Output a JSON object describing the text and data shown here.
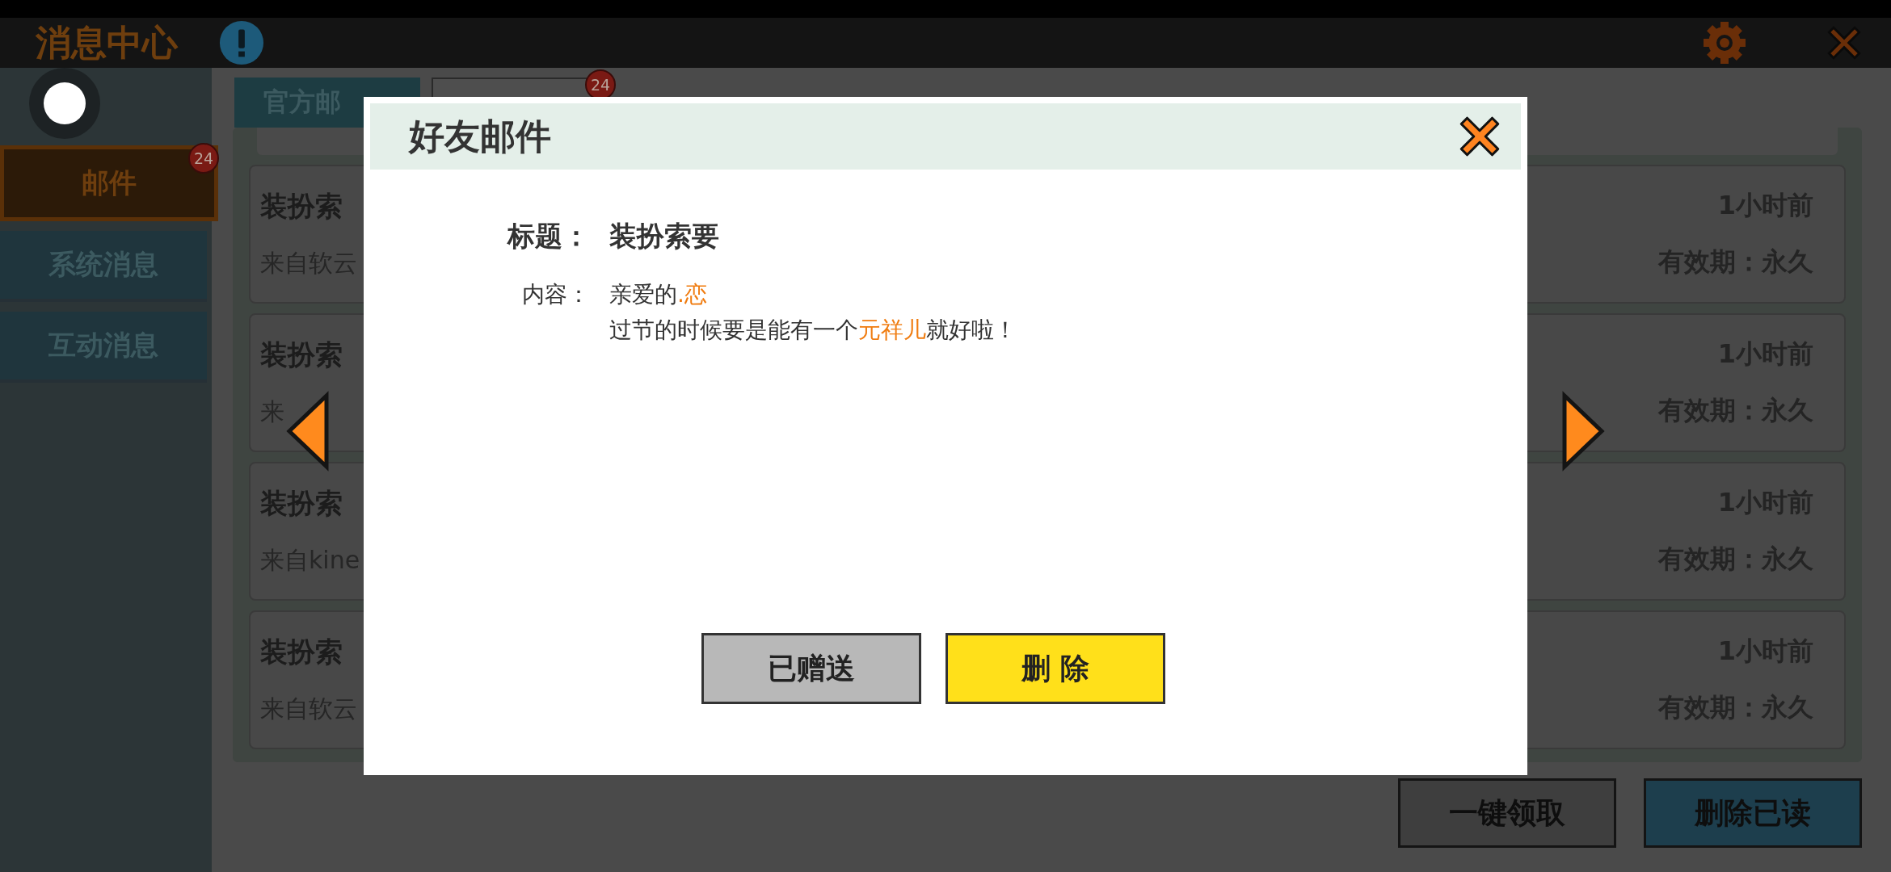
{
  "header": {
    "title": "消息中心"
  },
  "sidebar": {
    "items": [
      {
        "label": "邮件",
        "selected": true,
        "badge": "24"
      },
      {
        "label": "系统消息",
        "selected": false
      },
      {
        "label": "互动消息",
        "selected": false
      }
    ]
  },
  "tabs": [
    {
      "label": "官方邮",
      "selected": false
    },
    {
      "selected": true,
      "badge": "24"
    }
  ],
  "mail_rows": [
    {
      "title": "装扮索",
      "sender": "来自软云",
      "time": "1小时前",
      "validity": "有效期：永久"
    },
    {
      "title": "装扮索",
      "sender": "来",
      "time": "1小时前",
      "validity": "有效期：永久"
    },
    {
      "title": "装扮索",
      "sender": "来自kine",
      "time": "1小时前",
      "validity": "有效期：永久"
    },
    {
      "title": "装扮索",
      "sender": "来自软云",
      "time": "1小时前",
      "validity": "有效期：永久"
    }
  ],
  "footer_buttons": [
    {
      "label": "一键领取",
      "kind": "dark"
    },
    {
      "label": "删除已读",
      "kind": "blue"
    }
  ],
  "dialog": {
    "title": "好友邮件",
    "subject_label": "标题：",
    "subject": "装扮索要",
    "content_label": "内容：",
    "content": [
      "亲爱的**.恋**",
      "过节的时候要是能有一个**元祥儿**就好啦！"
    ],
    "buttons": [
      {
        "label": "已赠送",
        "kind": "grey"
      },
      {
        "label": "删 除",
        "kind": "yellow"
      }
    ]
  }
}
